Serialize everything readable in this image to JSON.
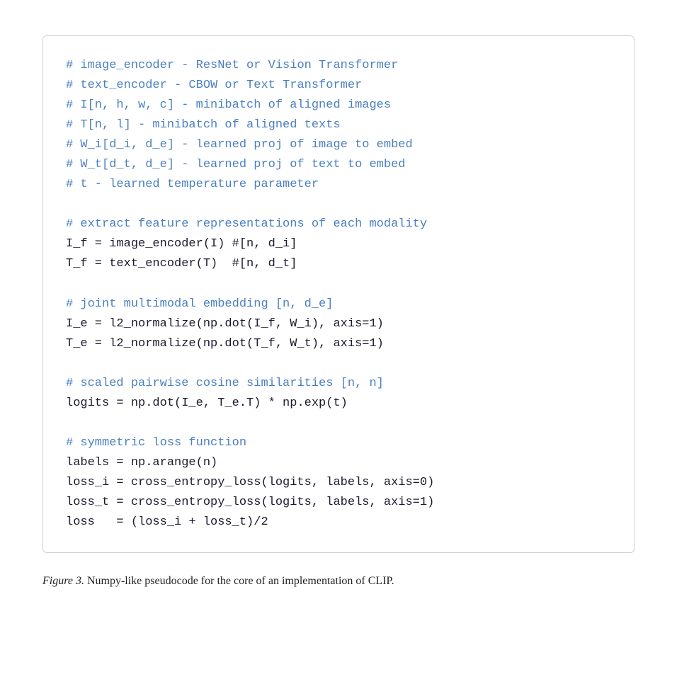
{
  "code": {
    "lines": [
      {
        "type": "comment",
        "text": "# image_encoder - ResNet or Vision Transformer"
      },
      {
        "type": "comment",
        "text": "# text_encoder  - CBOW or Text Transformer"
      },
      {
        "type": "comment",
        "text": "# I[n, h, w, c] - minibatch of aligned images"
      },
      {
        "type": "comment",
        "text": "# T[n, l]        - minibatch of aligned texts"
      },
      {
        "type": "comment",
        "text": "# W_i[d_i, d_e] - learned proj of image to embed"
      },
      {
        "type": "comment",
        "text": "# W_t[d_t, d_e] - learned proj of text to embed"
      },
      {
        "type": "comment",
        "text": "# t              - learned temperature parameter"
      },
      {
        "type": "empty"
      },
      {
        "type": "comment",
        "text": "# extract feature representations of each modality"
      },
      {
        "type": "code",
        "text": "I_f = image_encoder(I) #[n, d_i]"
      },
      {
        "type": "code",
        "text": "T_f = text_encoder(T)  #[n, d_t]"
      },
      {
        "type": "empty"
      },
      {
        "type": "comment",
        "text": "# joint multimodal embedding [n, d_e]"
      },
      {
        "type": "code",
        "text": "I_e = l2_normalize(np.dot(I_f, W_i), axis=1)"
      },
      {
        "type": "code",
        "text": "T_e = l2_normalize(np.dot(T_f, W_t), axis=1)"
      },
      {
        "type": "empty"
      },
      {
        "type": "comment",
        "text": "# scaled pairwise cosine similarities [n, n]"
      },
      {
        "type": "code",
        "text": "logits = np.dot(I_e, T_e.T) * np.exp(t)"
      },
      {
        "type": "empty"
      },
      {
        "type": "comment",
        "text": "# symmetric loss function"
      },
      {
        "type": "code",
        "text": "labels = np.arange(n)"
      },
      {
        "type": "code",
        "text": "loss_i = cross_entropy_loss(logits, labels, axis=0)"
      },
      {
        "type": "code",
        "text": "loss_t = cross_entropy_loss(logits, labels, axis=1)"
      },
      {
        "type": "code",
        "text": "loss   = (loss_i + loss_t)/2"
      }
    ]
  },
  "caption": {
    "figure_label": "Figure 3.",
    "text": " Numpy-like pseudocode for the core of an implementation of CLIP."
  }
}
